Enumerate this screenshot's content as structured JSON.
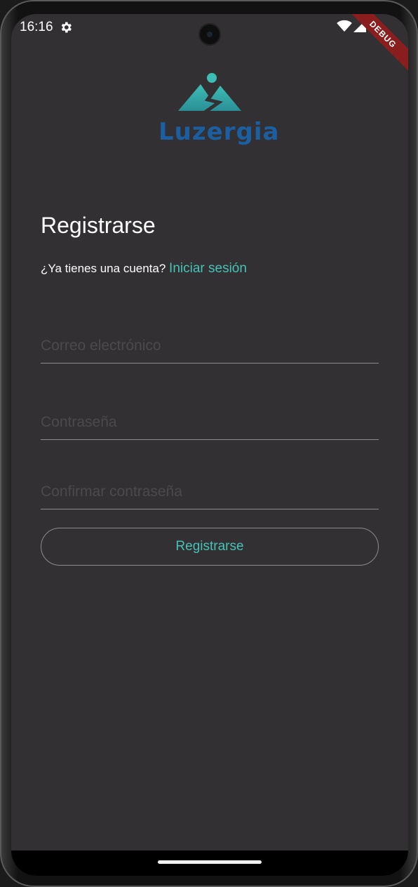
{
  "status_bar": {
    "time": "16:16",
    "icons": [
      "gear-icon",
      "wifi-icon",
      "signal-icon"
    ]
  },
  "debug_banner": "DEBUG",
  "logo": {
    "text": "Luzergia",
    "colors": {
      "mountain": "#3dbdb4",
      "text": "#1b5fa1"
    }
  },
  "register": {
    "title": "Registrarse",
    "account_prompt": "¿Ya tienes una cuenta?",
    "login_link": "Iniciar sesión",
    "fields": {
      "email": {
        "placeholder": "Correo electrónico",
        "value": ""
      },
      "password": {
        "placeholder": "Contraseña",
        "value": ""
      },
      "confirm_password": {
        "placeholder": "Confirmar contraseña",
        "value": ""
      }
    },
    "submit_label": "Registrarse"
  },
  "colors": {
    "background": "#323032",
    "accent": "#46c2b6",
    "divider": "#8c8c8c",
    "debug": "#8a1d1d"
  }
}
